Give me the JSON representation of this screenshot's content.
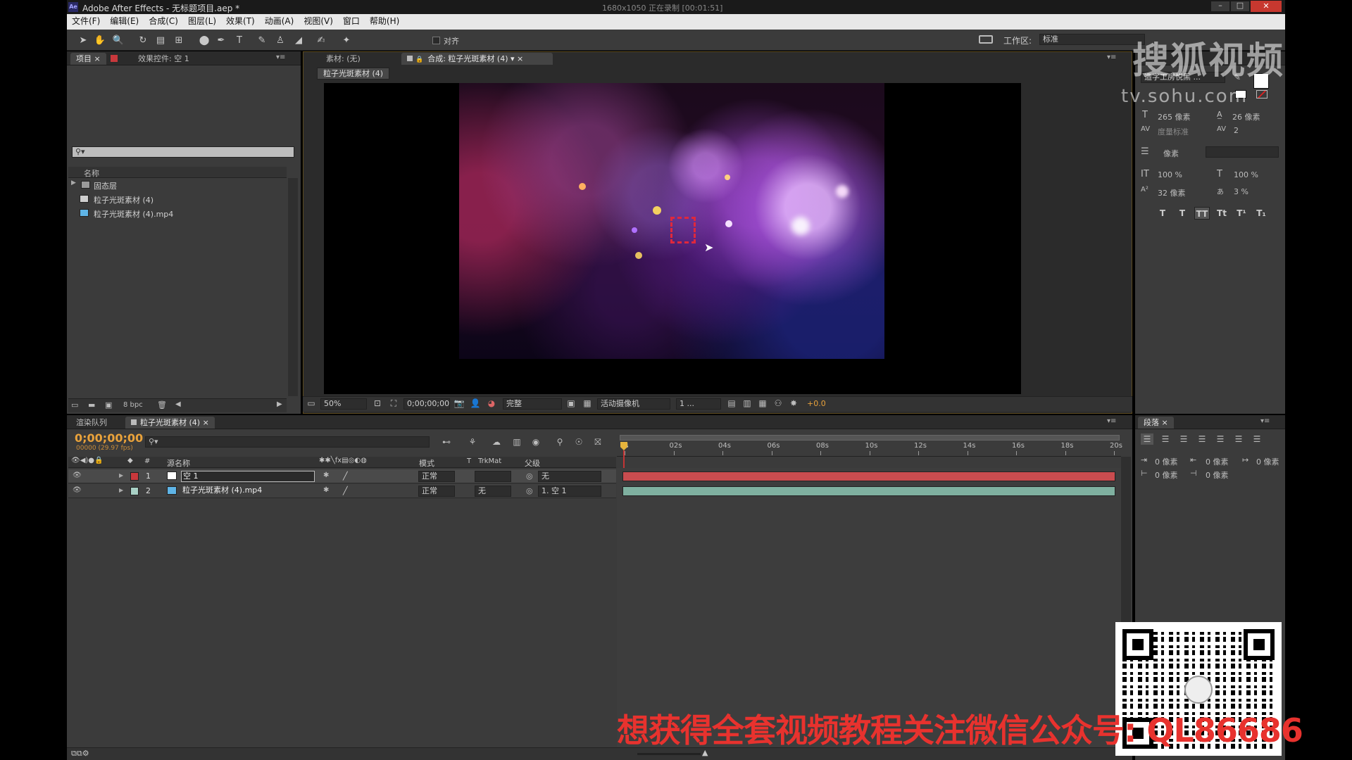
{
  "window": {
    "title": "Adobe After Effects - 无标题项目.aep *",
    "recording": "1680x1050  正在录制 [00:01:51]"
  },
  "menu": [
    "文件(F)",
    "编辑(E)",
    "合成(C)",
    "图层(L)",
    "效果(T)",
    "动画(A)",
    "视图(V)",
    "窗口",
    "帮助(H)"
  ],
  "toolbar": {
    "snap_label": "对齐",
    "workspace_label": "工作区:",
    "workspace_value": "标准"
  },
  "watermark": {
    "text": "搜狐视频",
    "url": "tv.sohu.com"
  },
  "project_panel": {
    "tab_project": "项目",
    "tab_effects": "效果控件: 空 1",
    "column_name": "名称",
    "items": [
      {
        "label": "固态层",
        "icon": "folder-icon"
      },
      {
        "label": "粒子光斑素材 (4)",
        "icon": "composition-icon"
      },
      {
        "label": "粒子光斑素材 (4).mp4",
        "icon": "footage-icon"
      }
    ],
    "bpc": "8 bpc"
  },
  "viewer": {
    "tab_footage": "素材: (无)",
    "tab_comp": "合成: 粒子光斑素材 (4)",
    "comp_button": "粒子光斑素材 (4)",
    "zoom": "50%",
    "timecode": "0;00;00;00",
    "resolution": "完整",
    "camera": "活动摄像机",
    "views": "1 ...",
    "exposure": "+0.0"
  },
  "character_panel": {
    "font": "造字工房悦黑 ...",
    "size": "265 像素",
    "leading": "26 像素",
    "kerning": "度量标准",
    "tracking": "2",
    "stroke_unit": "像素",
    "vscale": "100 %",
    "hscale": "100 %",
    "baseline": "32 像素",
    "tsume": "3 %",
    "styles": [
      "T",
      "T",
      "TT",
      "Tt",
      "T¹",
      "T₁"
    ]
  },
  "paragraph_panel": {
    "tab": "段落",
    "indents": [
      "0 像素",
      "0 像素",
      "0 像素",
      "0 像素",
      "0 像素"
    ]
  },
  "timeline": {
    "tab_render": "渲染队列",
    "tab_comp": "粒子光斑素材 (4)",
    "timecode": "0;00;00;00",
    "fps": "00000 (29.97 fps)",
    "headers": {
      "num": "#",
      "source_name": "源名称",
      "mode": "模式",
      "t": "T",
      "trkmat": "TrkMat",
      "parent": "父级"
    },
    "ruler": [
      "0s",
      "02s",
      "04s",
      "06s",
      "08s",
      "10s",
      "12s",
      "14s",
      "16s",
      "18s",
      "20s"
    ],
    "layers": [
      {
        "num": "1",
        "name": "空 1",
        "mode": "正常",
        "trkmat": "",
        "parent": "无",
        "label_color": "#c8383c",
        "bar_color": "#c94c4f"
      },
      {
        "num": "2",
        "name": "粒子光斑素材 (4).mp4",
        "mode": "正常",
        "trkmat": "无",
        "parent": "1. 空 1",
        "label_color": "#a8d0c5",
        "bar_color": "#7fb0a0"
      }
    ]
  },
  "overlay_text": "想获得全套视频教程关注微信公众号: QL86686"
}
